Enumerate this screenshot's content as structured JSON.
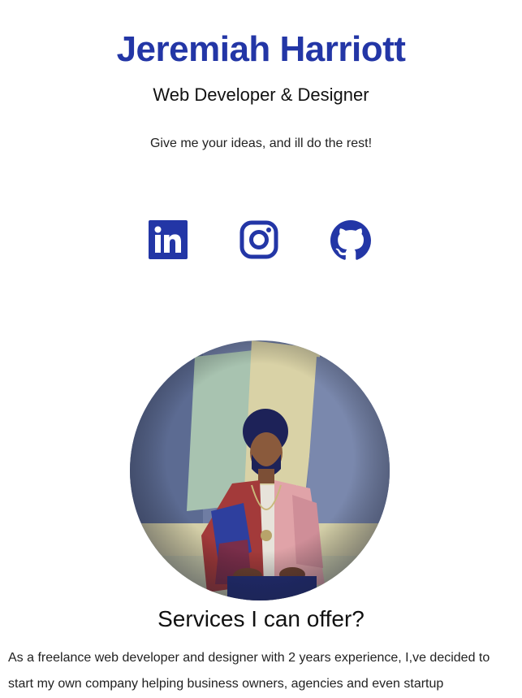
{
  "header": {
    "name": "Jeremiah Harriott",
    "role": "Web Developer & Designer",
    "tagline": "Give me your ideas, and ill do the rest!"
  },
  "social": [
    {
      "label": "LinkedIn",
      "icon": "linkedin-icon"
    },
    {
      "label": "Instagram",
      "icon": "instagram-icon"
    },
    {
      "label": "GitHub",
      "icon": "github-icon"
    }
  ],
  "colors": {
    "accent": "#2336a6",
    "text": "#111111",
    "background": "#ffffff"
  },
  "services": {
    "title": "Services I can offer?",
    "text": "As a freelance web developer and designer with 2 years experience, I,ve decided to start my own company helping business owners, agencies and even startup"
  }
}
